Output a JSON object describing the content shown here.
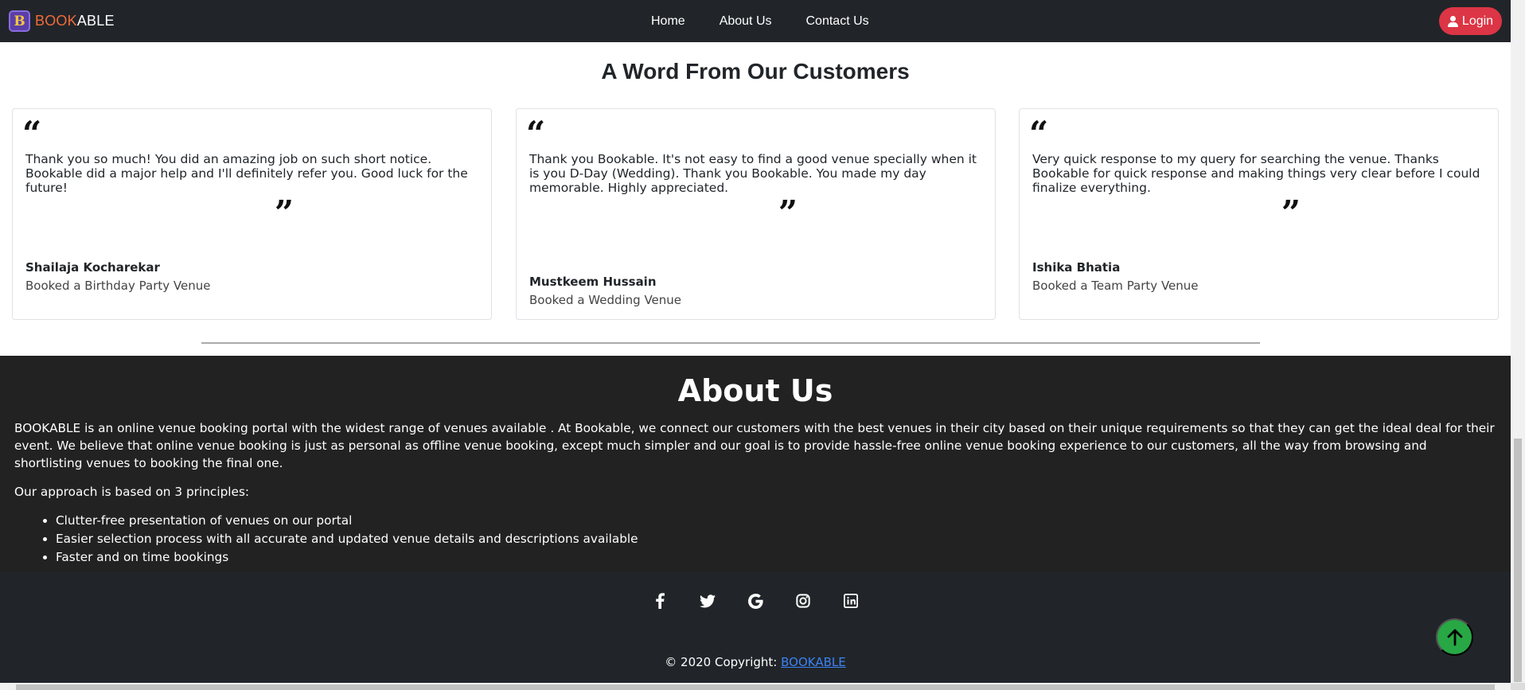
{
  "navbar": {
    "logo_letter": "B",
    "brand_part1": "BOOK",
    "brand_part2": "ABLE",
    "links": [
      "Home",
      "About Us",
      "Contact Us"
    ],
    "login_label": "Login"
  },
  "testimonials": {
    "title": "A Word From Our Customers",
    "cards": [
      {
        "text": "Thank you so much! You did an amazing job on such short notice. Bookable did a major help and I'll definitely refer you. Good luck for the future!",
        "name": "Shailaja Kocharekar",
        "subtitle": "Booked a Birthday Party Venue"
      },
      {
        "text": "Thank you Bookable. It's not easy to find a good venue specially when it is you D-Day (Wedding). Thank you Bookable. You made my day memorable. Highly appreciated.",
        "name": "Mustkeem Hussain",
        "subtitle": "Booked a Wedding Venue"
      },
      {
        "text": "Very quick response to my query for searching the venue. Thanks Bookable for quick response and making things very clear before I could finalize everything.",
        "name": "Ishika Bhatia",
        "subtitle": "Booked a Team Party Venue"
      }
    ]
  },
  "about": {
    "title": "About Us",
    "text": "BOOKABLE is an online venue booking portal with the widest range of venues available . At Bookable, we connect our customers with the best venues in their city based on their unique requirements so that they can get the ideal deal for their event. We believe that online venue booking is just as personal as offline venue booking, except much simpler and our goal is to provide hassle-free online venue booking experience to our customers, all the way from browsing and shortlisting venues to booking the final one.",
    "approach": "Our approach is based on 3 principles:",
    "principles": [
      "Clutter-free presentation of venues on our portal",
      "Easier selection process with all accurate and updated venue details and descriptions available",
      "Faster and on time bookings"
    ]
  },
  "footer": {
    "social": [
      "facebook-icon",
      "twitter-icon",
      "google-icon",
      "instagram-icon",
      "linkedin-icon"
    ],
    "copyright_prefix": "© 2020 Copyright: ",
    "copyright_link": "BOOKABLE"
  },
  "colors": {
    "navbar_bg": "#212529",
    "brand_orange": "#f26b3a",
    "login_red": "#dc3545",
    "about_bg": "#222222",
    "scroll_top_green": "#28a745",
    "link_blue": "#3b82f6"
  }
}
